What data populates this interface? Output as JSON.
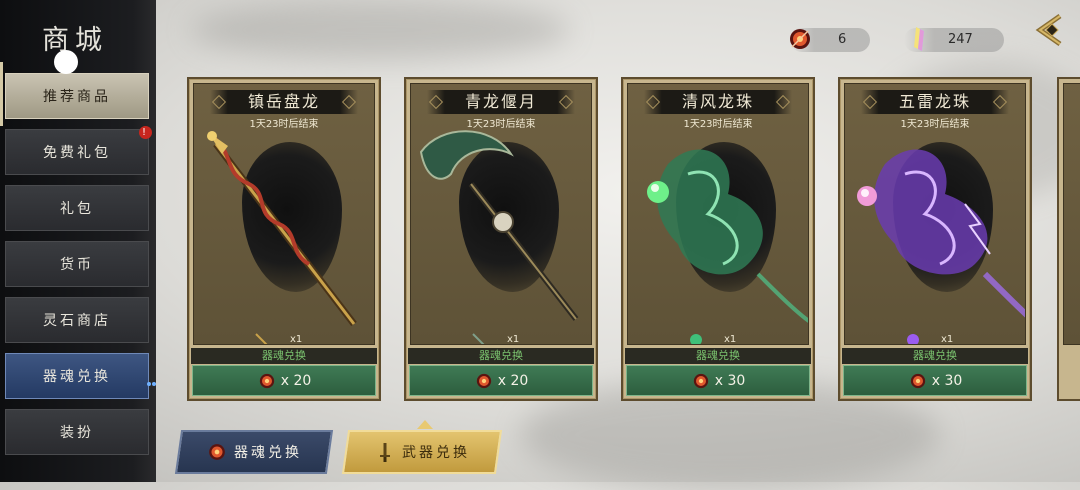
{
  "sidebar": {
    "title": "商城",
    "items": [
      {
        "label": "推荐商品"
      },
      {
        "label": "免费礼包",
        "badge": "!"
      },
      {
        "label": "礼包"
      },
      {
        "label": "货币"
      },
      {
        "label": "灵石商店"
      },
      {
        "label": "器魂兑换"
      },
      {
        "label": "装扮"
      }
    ]
  },
  "currency": [
    {
      "icon": "soul-orb-icon",
      "value": "6"
    },
    {
      "icon": "crystal-icon",
      "value": "247"
    }
  ],
  "cards": [
    {
      "title": "镇岳盘龙",
      "timer": "1天23时后结束",
      "qty": "x1",
      "exchange_label": "器魂兑换",
      "price": "x 20",
      "art": "dragon-staff",
      "accent": "#c9a24a"
    },
    {
      "title": "青龙偃月",
      "timer": "1天23时后结束",
      "qty": "x1",
      "exchange_label": "器魂兑换",
      "price": "x 20",
      "art": "crescent-blade",
      "accent": "#4f8a6a"
    },
    {
      "title": "清风龙珠",
      "timer": "1天23时后结束",
      "qty": "x1",
      "exchange_label": "器魂兑换",
      "price": "x 30",
      "art": "green-dragon-orb",
      "accent": "#3fc07a"
    },
    {
      "title": "五雷龙珠",
      "timer": "1天23时后结束",
      "qty": "x1",
      "exchange_label": "器魂兑换",
      "price": "x 30",
      "art": "purple-dragon-orb",
      "accent": "#9b5cf0"
    }
  ],
  "tabs": [
    {
      "label": "器魂兑换",
      "icon": "soul-orb-icon"
    },
    {
      "label": "武器兑换",
      "icon": "sword-icon"
    }
  ]
}
